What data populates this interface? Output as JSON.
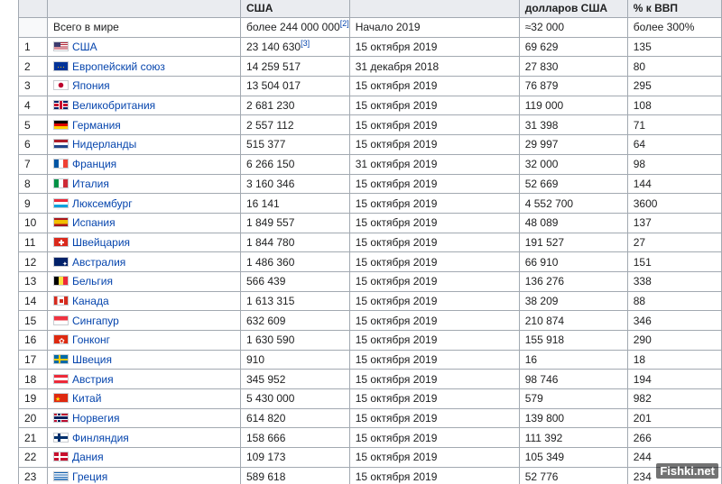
{
  "header": {
    "debt_header_partial": "США",
    "capita_header_partial": "долларов США",
    "gdp_header_partial": "% к ВВП"
  },
  "world": {
    "label": "Всего в мире",
    "debt": "более 244 000 000",
    "debt_ref": "[2]",
    "date": "Начало 2019",
    "per_capita": "≈32 000",
    "gdp_pct": "более 300%"
  },
  "rows": [
    {
      "rank": "1",
      "flag": "us-flag-icon",
      "country": "США",
      "debt": "23 140 630",
      "ref": "[3]",
      "date": "15 октября 2019",
      "per_capita": "69 629",
      "gdp_pct": "135"
    },
    {
      "rank": "2",
      "flag": "eu-flag-icon",
      "country": "Европейский союз",
      "debt": "14 259 517",
      "date": "31 декабря 2018",
      "per_capita": "27 830",
      "gdp_pct": "80"
    },
    {
      "rank": "3",
      "flag": "jp-flag-icon",
      "country": "Япония",
      "debt": "13 504 017",
      "date": "15 октября 2019",
      "per_capita": "76 879",
      "gdp_pct": "295"
    },
    {
      "rank": "4",
      "flag": "gb-flag-icon",
      "country": "Великобритания",
      "debt": "2 681 230",
      "date": "15 октября 2019",
      "per_capita": "119 000",
      "gdp_pct": "108"
    },
    {
      "rank": "5",
      "flag": "de-flag-icon",
      "country": "Германия",
      "debt": "2 557 112",
      "date": "15 октября 2019",
      "per_capita": "31 398",
      "gdp_pct": "71"
    },
    {
      "rank": "6",
      "flag": "nl-flag-icon",
      "country": "Нидерланды",
      "debt": "515 377",
      "date": "15 октября 2019",
      "per_capita": "29 997",
      "gdp_pct": "64"
    },
    {
      "rank": "7",
      "flag": "fr-flag-icon",
      "country": "Франция",
      "debt": "6 266 150",
      "date": "31 октября 2019",
      "per_capita": "32 000",
      "gdp_pct": "98"
    },
    {
      "rank": "8",
      "flag": "it-flag-icon",
      "country": "Италия",
      "debt": "3 160 346",
      "date": "15 октября 2019",
      "per_capita": "52 669",
      "gdp_pct": "144"
    },
    {
      "rank": "9",
      "flag": "lu-flag-icon",
      "country": "Люксембург",
      "debt": "16 141",
      "date": "15 октября 2019",
      "per_capita": "4 552 700",
      "gdp_pct": "3600"
    },
    {
      "rank": "10",
      "flag": "es-flag-icon",
      "country": "Испания",
      "debt": "1 849 557",
      "date": "15 октября 2019",
      "per_capita": "48 089",
      "gdp_pct": "137"
    },
    {
      "rank": "11",
      "flag": "ch-flag-icon",
      "country": "Швейцария",
      "debt": "1 844 780",
      "date": "15 октября 2019",
      "per_capita": "191 527",
      "gdp_pct": "27"
    },
    {
      "rank": "12",
      "flag": "au-flag-icon",
      "country": "Австралия",
      "debt": "1 486 360",
      "date": "15 октября 2019",
      "per_capita": "66 910",
      "gdp_pct": "151"
    },
    {
      "rank": "13",
      "flag": "be-flag-icon",
      "country": "Бельгия",
      "debt": "566 439",
      "date": "15 октября 2019",
      "per_capita": "136 276",
      "gdp_pct": "338"
    },
    {
      "rank": "14",
      "flag": "ca-flag-icon",
      "country": "Канада",
      "debt": "1 613 315",
      "date": "15 октября 2019",
      "per_capita": "38 209",
      "gdp_pct": "88"
    },
    {
      "rank": "15",
      "flag": "sg-flag-icon",
      "country": "Сингапур",
      "debt": "632 609",
      "date": "15 октября 2019",
      "per_capita": "210 874",
      "gdp_pct": "346"
    },
    {
      "rank": "16",
      "flag": "hk-flag-icon",
      "country": "Гонконг",
      "debt": "1 630 590",
      "date": "15 октября 2019",
      "per_capita": "155 918",
      "gdp_pct": "290"
    },
    {
      "rank": "17",
      "flag": "se-flag-icon",
      "country": "Швеция",
      "debt": "910",
      "date": "15 октября 2019",
      "per_capita": "16",
      "gdp_pct": "18"
    },
    {
      "rank": "18",
      "flag": "at-flag-icon",
      "country": "Австрия",
      "debt": "345 952",
      "date": "15 октября 2019",
      "per_capita": "98 746",
      "gdp_pct": "194"
    },
    {
      "rank": "19",
      "flag": "cn-flag-icon",
      "country": "Китай",
      "debt": "5 430 000",
      "date": "15 октября 2019",
      "per_capita": "579",
      "gdp_pct": "982"
    },
    {
      "rank": "20",
      "flag": "no-flag-icon",
      "country": "Норвегия",
      "debt": "614 820",
      "date": "15 октября 2019",
      "per_capita": "139 800",
      "gdp_pct": "201"
    },
    {
      "rank": "21",
      "flag": "fi-flag-icon",
      "country": "Финляндия",
      "debt": "158 666",
      "date": "15 октября 2019",
      "per_capita": "111 392",
      "gdp_pct": "266"
    },
    {
      "rank": "22",
      "flag": "dk-flag-icon",
      "country": "Дания",
      "debt": "109 173",
      "date": "15 октября 2019",
      "per_capita": "105 349",
      "gdp_pct": "244"
    },
    {
      "rank": "23",
      "flag": "gr-flag-icon",
      "country": "Греция",
      "debt": "589 618",
      "date": "15 октября 2019",
      "per_capita": "52 776",
      "gdp_pct": "234"
    }
  ],
  "watermark": "Fishki.net"
}
